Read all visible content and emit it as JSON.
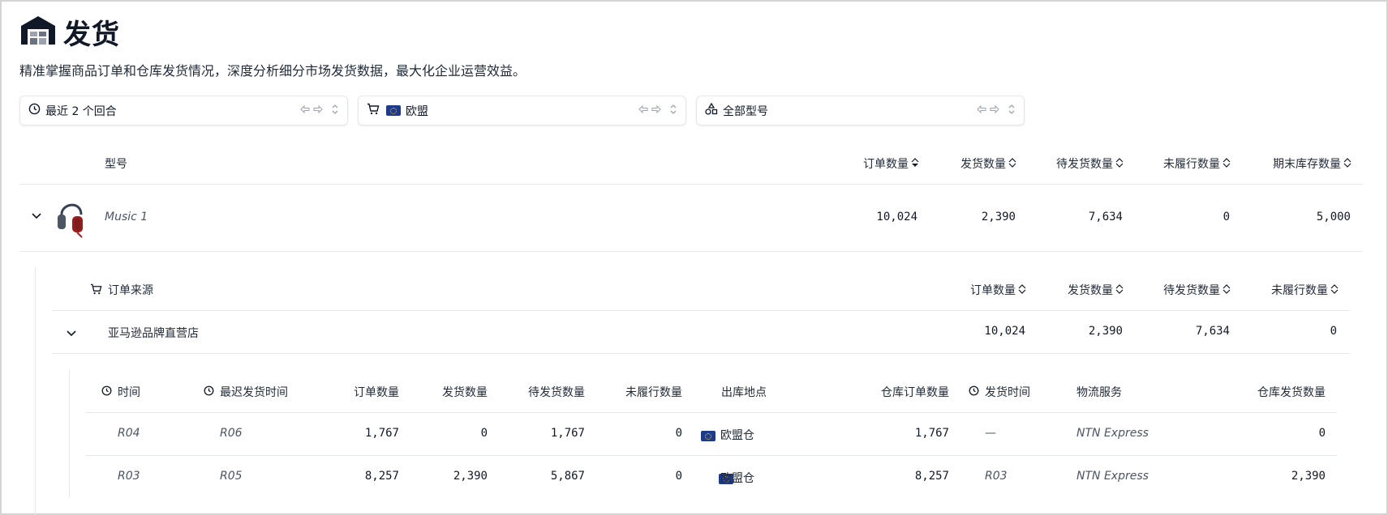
{
  "page": {
    "title": "发货",
    "subtitle": "精准掌握商品订单和仓库发货情况，深度分析细分市场发货数据，最大化企业运营效益。"
  },
  "filters": [
    {
      "label": "最近 2 个回合",
      "icon": "clock-icon"
    },
    {
      "label": "欧盟",
      "icon": "cart-icon",
      "flag": "eu-flag"
    },
    {
      "label": "全部型号",
      "icon": "shapes-icon"
    }
  ],
  "model_table": {
    "headers": {
      "model": "型号",
      "orders": "订单数量",
      "shipped": "发货数量",
      "pending": "待发货数量",
      "unfulfilled": "未履行数量",
      "ending_stock": "期末库存数量"
    },
    "row": {
      "name": "Music 1",
      "orders": "10,024",
      "shipped": "2,390",
      "pending": "7,634",
      "unfulfilled": "0",
      "ending_stock": "5,000"
    }
  },
  "source_table": {
    "headers": {
      "source": "订单来源",
      "orders": "订单数量",
      "shipped": "发货数量",
      "pending": "待发货数量",
      "unfulfilled": "未履行数量"
    },
    "row": {
      "source": "亚马逊品牌直营店",
      "orders": "10,024",
      "shipped": "2,390",
      "pending": "7,634",
      "unfulfilled": "0"
    }
  },
  "detail_table": {
    "headers": {
      "time": "时间",
      "latest_ship": "最迟发货时间",
      "orders": "订单数量",
      "shipped": "发货数量",
      "pending": "待发货数量",
      "unfulfilled": "未履行数量",
      "location": "出库地点",
      "wh_orders": "仓库订单数量",
      "ship_time": "发货时间",
      "logistics": "物流服务",
      "wh_shipped": "仓库发货数量"
    },
    "rows": [
      {
        "time": "R04",
        "latest_ship": "R06",
        "orders": "1,767",
        "shipped": "0",
        "pending": "1,767",
        "unfulfilled": "0",
        "location": "欧盟仓",
        "wh_orders": "1,767",
        "ship_time": "—",
        "logistics": "NTN Express",
        "wh_shipped": "0"
      },
      {
        "time": "R03",
        "latest_ship": "R05",
        "orders": "8,257",
        "shipped": "2,390",
        "pending": "5,867",
        "unfulfilled": "0",
        "location": "欧盟仓",
        "wh_orders": "8,257",
        "ship_time": "R03",
        "logistics": "NTN Express",
        "wh_shipped": "2,390"
      }
    ]
  },
  "colors": {
    "accent": "#1e3a8a",
    "border": "#e5e7eb",
    "text": "#1f2937"
  }
}
